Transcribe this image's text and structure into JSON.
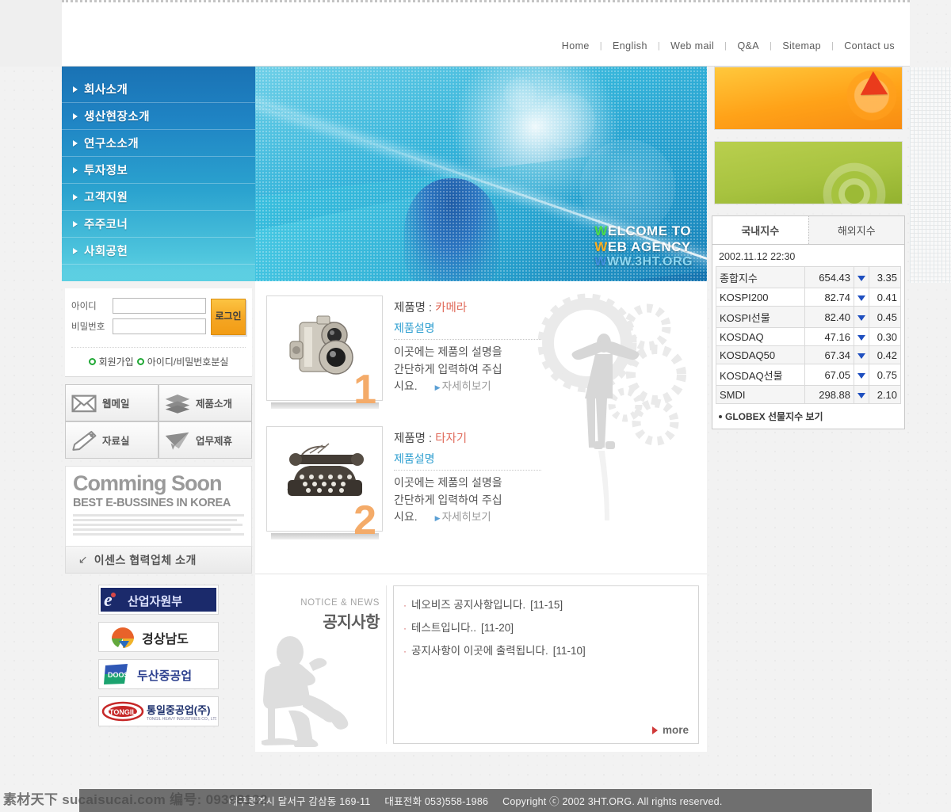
{
  "topnav": {
    "items": [
      {
        "label": "Home"
      },
      {
        "label": "English"
      },
      {
        "label": "Web mail"
      },
      {
        "label": "Q&A"
      },
      {
        "label": "Sitemap"
      },
      {
        "label": "Contact us"
      }
    ],
    "separator": "|"
  },
  "sidebar": {
    "items": [
      {
        "label": "회사소개"
      },
      {
        "label": "생산현장소개"
      },
      {
        "label": "연구소소개"
      },
      {
        "label": "투자정보"
      },
      {
        "label": "고객지원"
      },
      {
        "label": "주주코너"
      },
      {
        "label": "사회공헌"
      }
    ]
  },
  "login": {
    "id_label": "아이디",
    "id_value": "",
    "id_placeholder": "",
    "pw_label": "비밀번호",
    "pw_value": "",
    "pw_placeholder": "",
    "submit_label": "로그인",
    "link_join": "회원가입",
    "link_lost": "아이디/비밀번호분실"
  },
  "quicklinks": [
    {
      "label": "웹메일",
      "icon": "envelope-icon"
    },
    {
      "label": "제품소개",
      "icon": "books-icon"
    },
    {
      "label": "자료실",
      "icon": "pencil-icon"
    },
    {
      "label": "업무제휴",
      "icon": "paper-plane-icon"
    }
  ],
  "coming_soon": {
    "title": "Comming Soon",
    "subtitle": "BEST E-BUSSINES IN KOREA"
  },
  "partner_bar": {
    "label": "이센스 협력업체 소개"
  },
  "partner_logos": [
    {
      "name": "산업자원부"
    },
    {
      "name": "경상남도"
    },
    {
      "name": "두산중공업",
      "latin": "DOOSAN"
    },
    {
      "name": "통일중공업(주)",
      "latin": "TONGIL"
    }
  ],
  "hero": {
    "line1_first": "W",
    "line1_rest": "ELCOME TO",
    "line2_first": "W",
    "line2_rest": "EB AGENCY",
    "line3_first": "W",
    "line3_rest": "WW.3HT.ORG"
  },
  "products": [
    {
      "number": "1",
      "name_label": "제품명 :",
      "name_value": "카메라",
      "desc_header": "제품설명",
      "desc_line1": "이곳에는 제품의 설명을",
      "desc_line2": "간단하게 입력하여 주십",
      "desc_line3": "시요.",
      "detail_link": "자세히보기",
      "image": "vintage-camera"
    },
    {
      "number": "2",
      "name_label": "제품명 :",
      "name_value": "타자기",
      "desc_header": "제품설명",
      "desc_line1": "이곳에는 제품의 설명을",
      "desc_line2": "간단하게 입력하여 주십",
      "desc_line3": "시요.",
      "detail_link": "자세히보기",
      "image": "vintage-typewriter"
    }
  ],
  "notice": {
    "title_en": "NOTICE & NEWS",
    "title_ko": "공지사항",
    "items": [
      {
        "text": "네오비즈 공지사항입니다.",
        "date": "[11-15]"
      },
      {
        "text": "테스트입니다..",
        "date": "[11-20]"
      },
      {
        "text": "공지사항이 이곳에 출력됩니다.",
        "date": "[11-10]"
      }
    ],
    "more_label": "more"
  },
  "banners": [
    {
      "name": "orange-arrow-banner",
      "accent": "#ea3b1c"
    },
    {
      "name": "green-target-banner",
      "accent": "#93b22f"
    }
  ],
  "stock": {
    "tabs": [
      {
        "label": "국내지수",
        "active": true
      },
      {
        "label": "해외지수",
        "active": false
      }
    ],
    "timestamp": "2002.11.12 22:30",
    "rows": [
      {
        "name": "종합지수",
        "value": "654.43",
        "dir": "down",
        "change": "3.35"
      },
      {
        "name": "KOSPI200",
        "value": "82.74",
        "dir": "down",
        "change": "0.41"
      },
      {
        "name": "KOSPI선물",
        "value": "82.40",
        "dir": "down",
        "change": "0.45"
      },
      {
        "name": "KOSDAQ",
        "value": "47.16",
        "dir": "down",
        "change": "0.30"
      },
      {
        "name": "KOSDAQ50",
        "value": "67.34",
        "dir": "down",
        "change": "0.42"
      },
      {
        "name": "KOSDAQ선물",
        "value": "67.05",
        "dir": "down",
        "change": "0.75"
      },
      {
        "name": "SMDI",
        "value": "298.88",
        "dir": "down",
        "change": "2.10"
      }
    ],
    "globex_link": "GLOBEX 선물지수 보기"
  },
  "footer": {
    "address": "대구광역시 달서구 감삼동 169-11",
    "phone": "대표전화 053)558-1986",
    "copyright": "Copyright ⓒ 2002 3HT.ORG. All rights reserved."
  },
  "watermark": {
    "text": "素材天下 sucaisucai.com  编号: 09398132"
  }
}
